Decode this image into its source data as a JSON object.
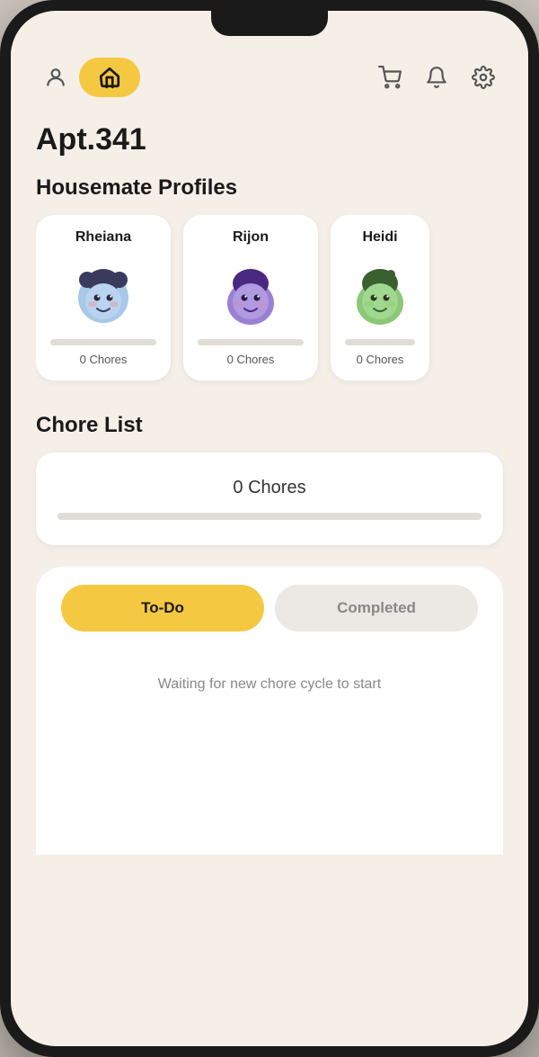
{
  "app": {
    "apt_label": "Apt.341"
  },
  "nav": {
    "home_icon": "home",
    "person_icon": "person",
    "cart_icon": "cart",
    "bell_icon": "bell",
    "gear_icon": "gear"
  },
  "sections": {
    "profiles_title": "Housemate Profiles",
    "chore_list_title": "Chore List"
  },
  "profiles": [
    {
      "name": "Rheiana",
      "chores": "0 Chores",
      "avatar": "rheiana"
    },
    {
      "name": "Rijon",
      "chores": "0 Chores",
      "avatar": "rijon"
    },
    {
      "name": "Heidi",
      "chores": "0 Chores",
      "avatar": "heidi"
    }
  ],
  "chore_list": {
    "count": "0 Chores"
  },
  "tabs": {
    "todo": "To-Do",
    "completed": "Completed"
  },
  "empty_state": {
    "message": "Waiting for new chore cycle to start"
  }
}
